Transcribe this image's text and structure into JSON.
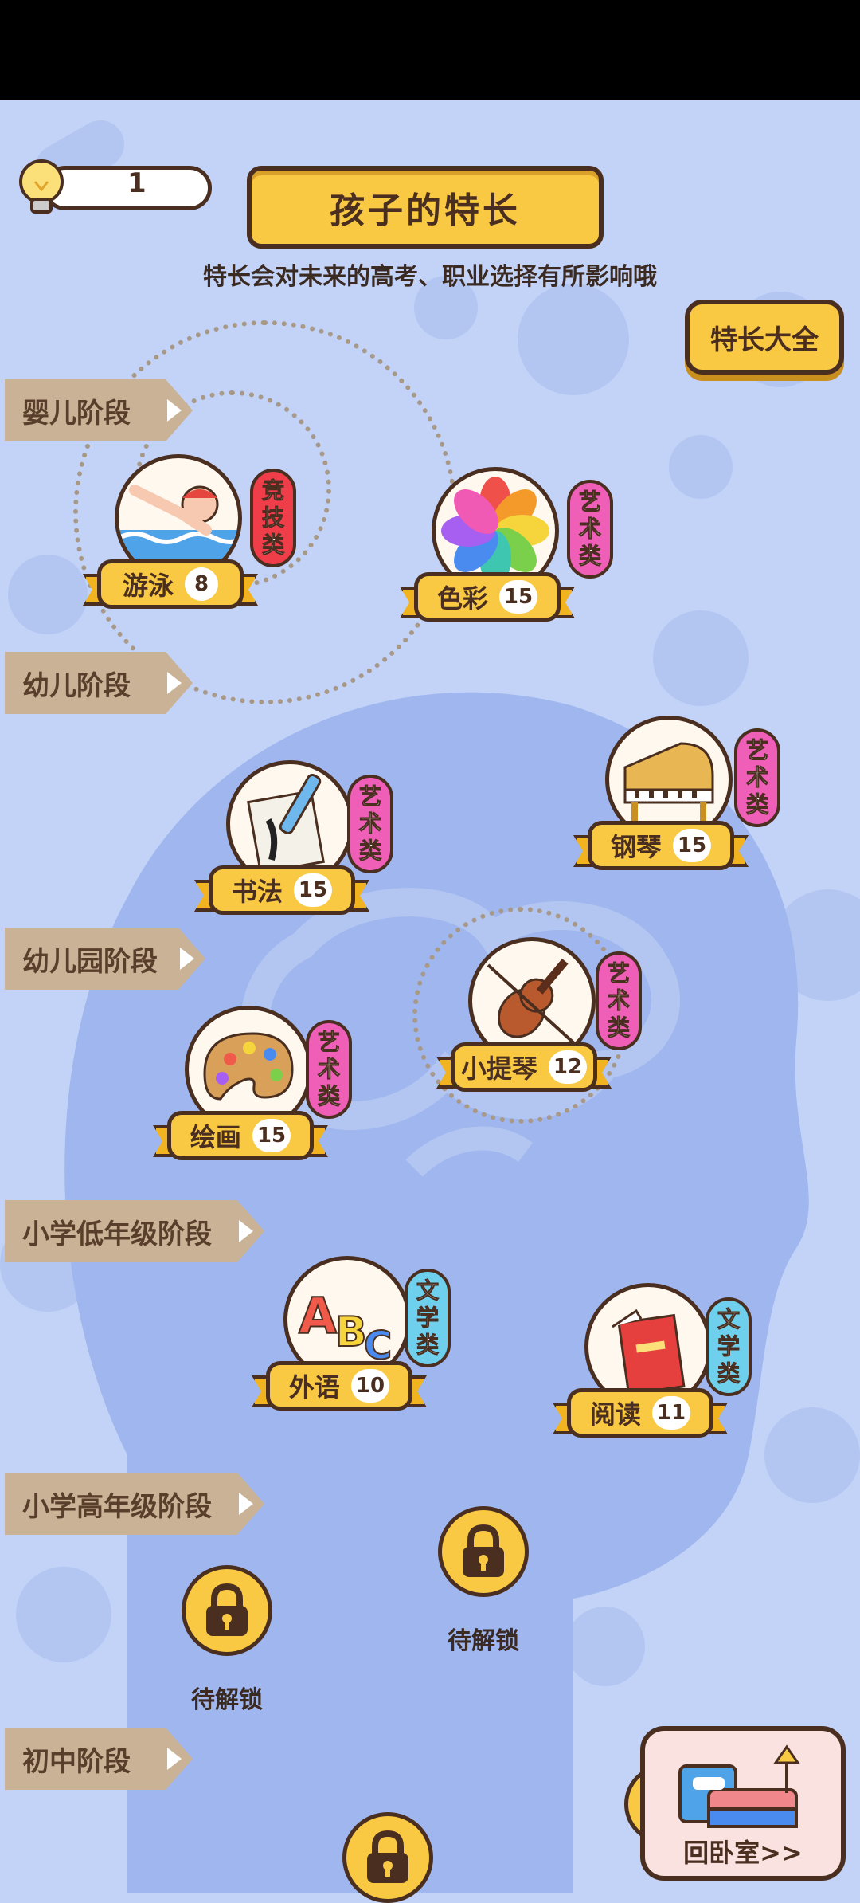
{
  "header": {
    "bulb_count": "1",
    "title": "孩子的特长",
    "subtitle": "特长会对未来的高考、职业选择有所影响哦",
    "all_button": "特长大全"
  },
  "stages": [
    "婴儿阶段",
    "幼儿阶段",
    "幼儿园阶段",
    "小学低年级阶段",
    "小学高年级阶段",
    "初中阶段"
  ],
  "skills": [
    {
      "name": "游泳",
      "level": "8",
      "category": "竞技类",
      "cat_color": "#ef3d4a",
      "icon": "swimmer-icon"
    },
    {
      "name": "色彩",
      "level": "15",
      "category": "艺术类",
      "cat_color": "#ef5fb8",
      "icon": "color-wheel-icon"
    },
    {
      "name": "钢琴",
      "level": "15",
      "category": "艺术类",
      "cat_color": "#ef5fb8",
      "icon": "piano-icon"
    },
    {
      "name": "书法",
      "level": "15",
      "category": "艺术类",
      "cat_color": "#ef5fb8",
      "icon": "calligraphy-brush-icon"
    },
    {
      "name": "小提琴",
      "level": "12",
      "category": "艺术类",
      "cat_color": "#ef5fb8",
      "icon": "violin-icon"
    },
    {
      "name": "绘画",
      "level": "15",
      "category": "艺术类",
      "cat_color": "#ef5fb8",
      "icon": "palette-icon"
    },
    {
      "name": "外语",
      "level": "10",
      "category": "文学类",
      "cat_color": "#6fd0ee",
      "icon": "abc-letters-icon"
    },
    {
      "name": "阅读",
      "level": "11",
      "category": "文学类",
      "cat_color": "#6fd0ee",
      "icon": "book-icon"
    }
  ],
  "locked": {
    "label": "待解锁"
  },
  "bedroom_button": "回卧室>>"
}
